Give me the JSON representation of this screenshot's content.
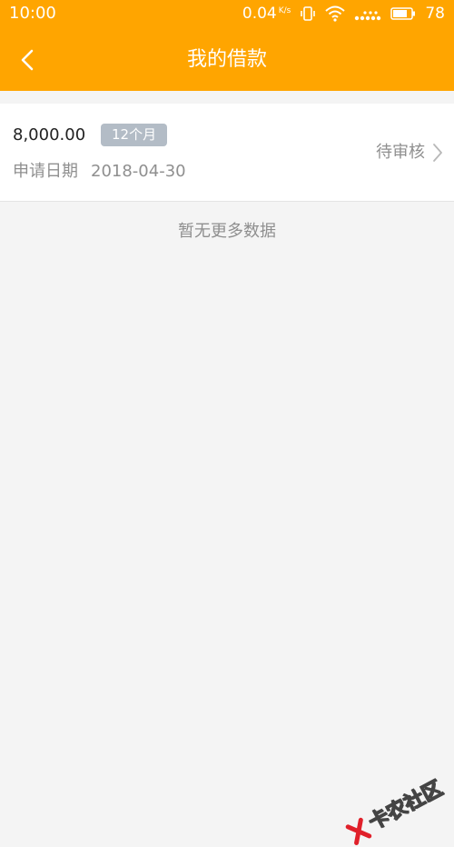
{
  "status_bar": {
    "time": "10:00",
    "net_speed": "0.04",
    "net_speed_unit": "K/s",
    "signal_type": "4G",
    "battery_percent": "78"
  },
  "header": {
    "title": "我的借款",
    "back_icon": "chevron-left-icon"
  },
  "loans": [
    {
      "amount": "8,000.00",
      "term": "12个月",
      "apply_label": "申请日期",
      "apply_date": "2018-04-30",
      "status": "待审核"
    }
  ],
  "footer_message": "暂无更多数据",
  "watermark": "卡农社区",
  "colors": {
    "brand_orange": "#ffa500",
    "badge_gray": "#b3bcc6",
    "watermark_red": "#e0202a",
    "text_dark": "#222222",
    "text_muted": "#8f8f8f",
    "page_background": "#f4f4f4"
  }
}
